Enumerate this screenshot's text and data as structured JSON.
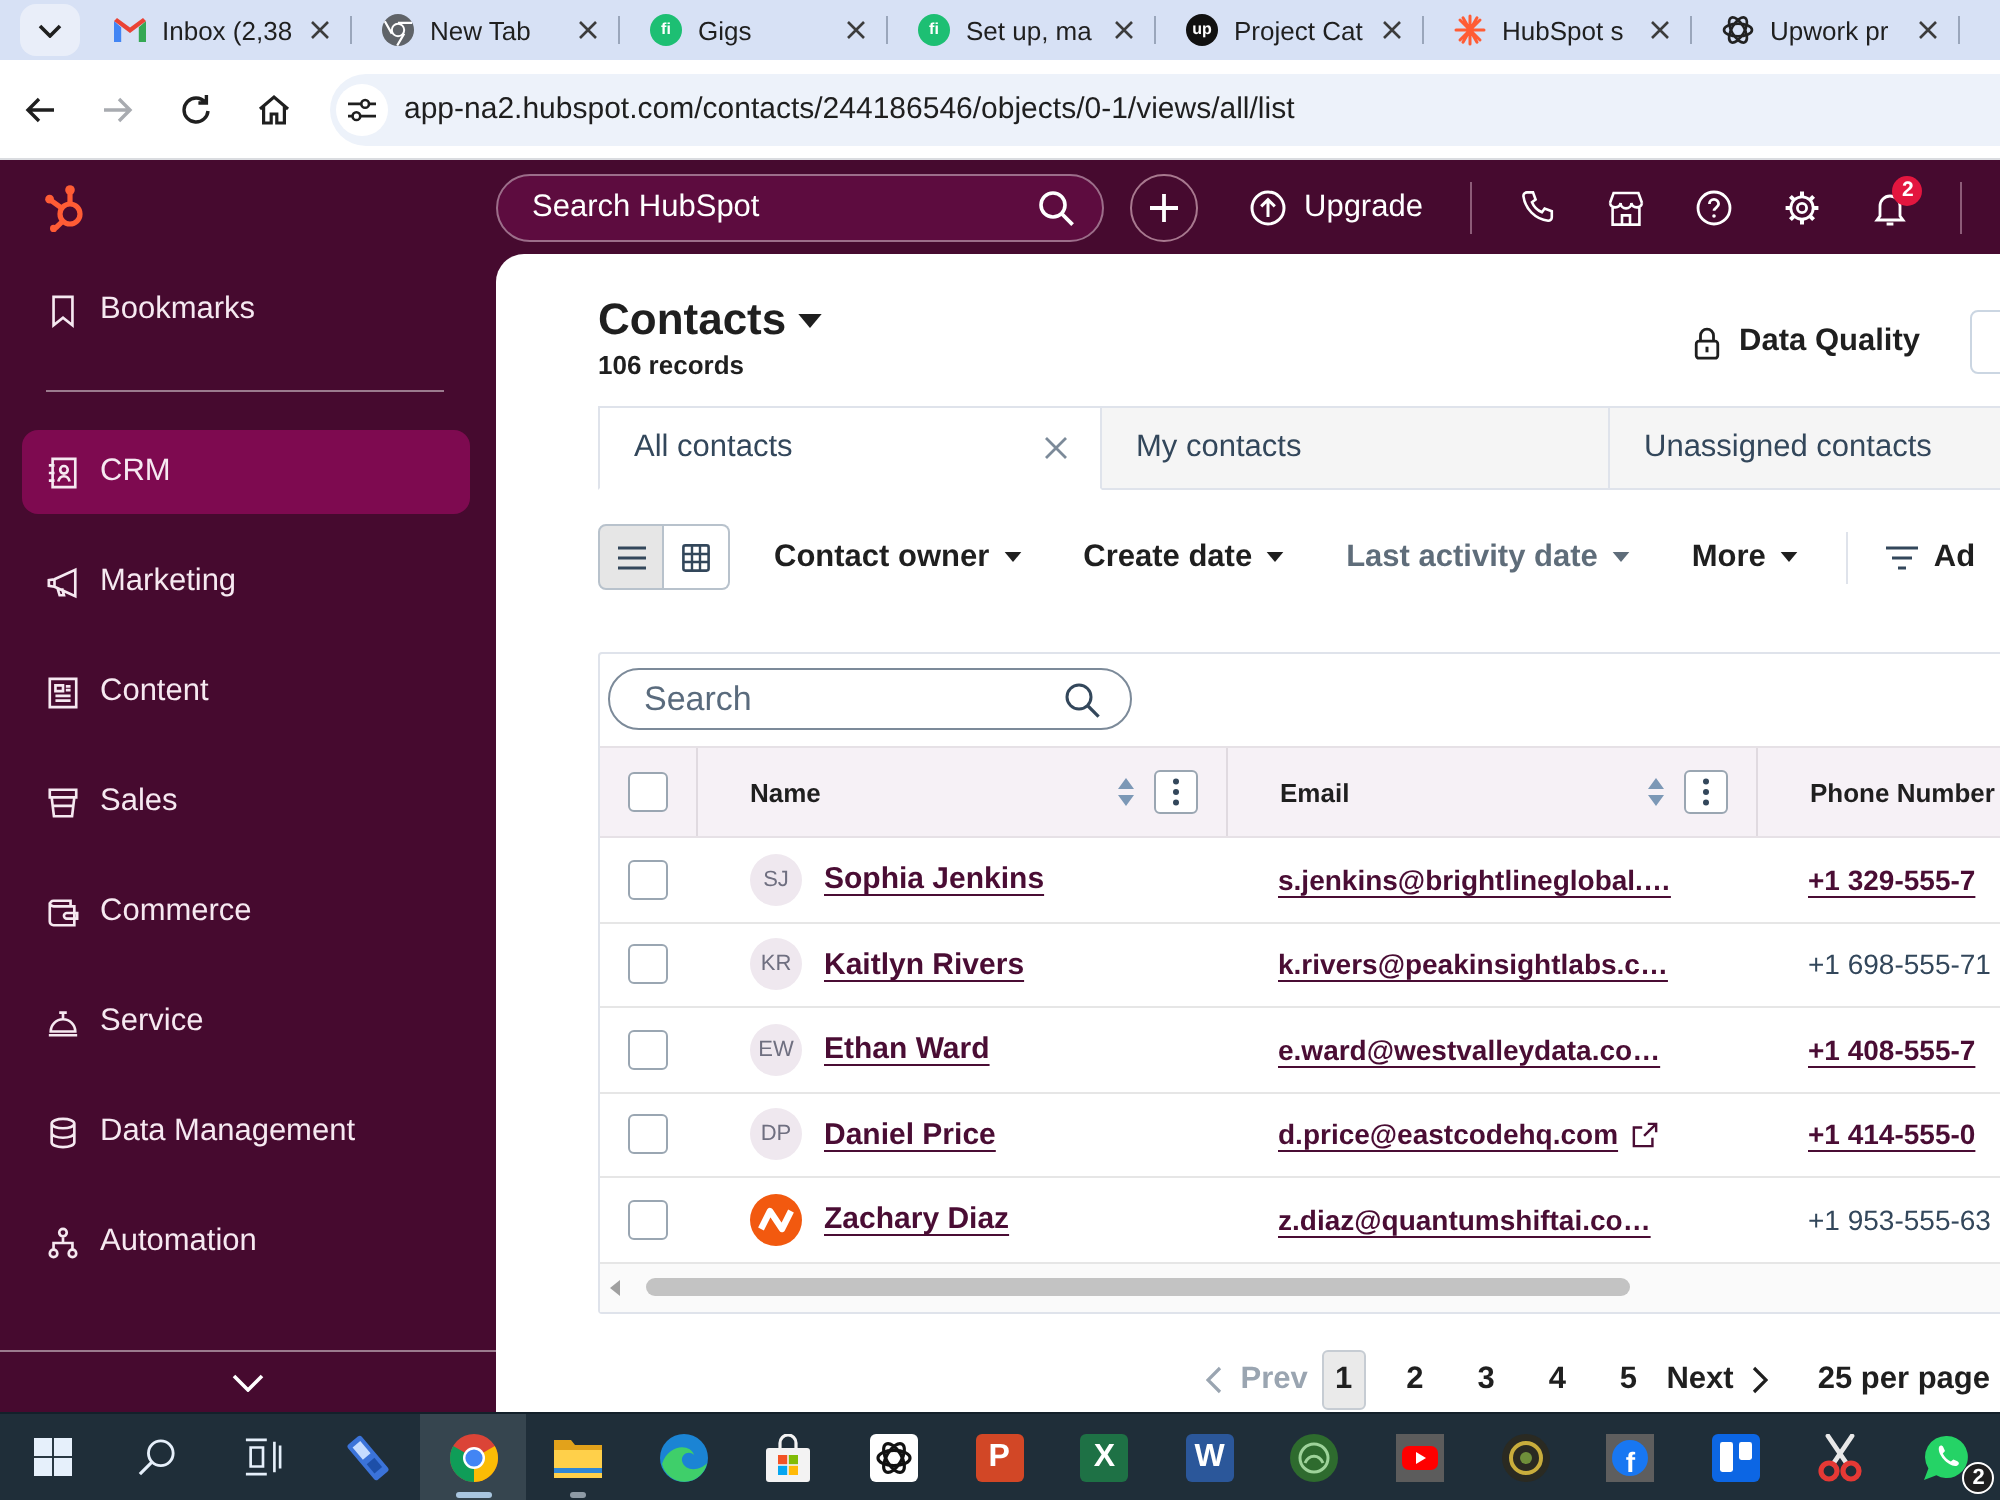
{
  "browser": {
    "tabs": [
      {
        "title": "Inbox (2,38",
        "kind": "mail",
        "selected": false
      },
      {
        "title": "New Tab",
        "kind": "chrome",
        "selected": false
      },
      {
        "title": "Gigs",
        "kind": "greenbadge",
        "icon_text": "fi",
        "selected": false
      },
      {
        "title": "Set up, ma",
        "kind": "greenbadge",
        "icon_text": "fi",
        "selected": false
      },
      {
        "title": "Project Cat",
        "kind": "darkbadge",
        "icon_text": "up",
        "selected": false
      },
      {
        "title": "HubSpot s",
        "kind": "starburst",
        "selected": false
      },
      {
        "title": "Upwork pr",
        "kind": "knot",
        "selected": false
      }
    ],
    "forward_disabled": true,
    "url": "app-na2.hubspot.com/contacts/244186546/objects/0-1/views/all/list"
  },
  "topnav": {
    "search": {
      "placeholder": "Search HubSpot"
    },
    "upgrade": "Upgrade",
    "notification_count": "2"
  },
  "sidebar": {
    "bookmarks": {
      "label": "Bookmarks"
    },
    "items": [
      {
        "label": "CRM",
        "kind": "contacts",
        "selected": true
      },
      {
        "label": "Marketing",
        "kind": "megaphone",
        "selected": false
      },
      {
        "label": "Content",
        "kind": "document",
        "selected": false
      },
      {
        "label": "Sales",
        "kind": "bucket",
        "selected": false
      },
      {
        "label": "Commerce",
        "kind": "wallet",
        "selected": false
      },
      {
        "label": "Service",
        "kind": "bell",
        "selected": false
      },
      {
        "label": "Data Management",
        "kind": "database",
        "selected": false
      },
      {
        "label": "Automation",
        "kind": "hierarchy",
        "selected": false
      }
    ]
  },
  "page": {
    "title": "Contacts",
    "record_count": "106 records",
    "data_quality": "Data Quality"
  },
  "views": [
    {
      "label": "All contacts",
      "selected": true,
      "closable": true
    },
    {
      "label": "My contacts",
      "selected": false,
      "closable": false
    },
    {
      "label": "Unassigned contacts",
      "selected": false,
      "closable": false
    }
  ],
  "toolbar": {
    "view_modes": [
      {
        "kind": "list",
        "selected": true
      },
      {
        "kind": "grid",
        "selected": false
      }
    ],
    "filters": [
      {
        "label": "Contact owner",
        "muted": false
      },
      {
        "label": "Create date",
        "muted": false
      },
      {
        "label": "Last activity date",
        "muted": true
      },
      {
        "label": "More",
        "muted": false
      }
    ],
    "advanced": "Ad"
  },
  "table": {
    "search": {
      "placeholder": "Search"
    },
    "header_checked": false,
    "columns": [
      {
        "label": "Name",
        "sortable": true
      },
      {
        "label": "Email",
        "sortable": true
      },
      {
        "label": "Phone Number",
        "sortable": false
      }
    ],
    "rows": [
      {
        "checked": false,
        "avatar": {
          "kind": "initials",
          "text": "SJ"
        },
        "name": "Sophia Jenkins",
        "email": "s.jenkins@brightlineglobal.…",
        "email_external": false,
        "phone": "+1 329-555-7",
        "phone_linked": true
      },
      {
        "checked": false,
        "avatar": {
          "kind": "initials",
          "text": "KR"
        },
        "name": "Kaitlyn Rivers",
        "email": "k.rivers@peakinsightlabs.c…",
        "email_external": false,
        "phone": "+1 698-555-71",
        "phone_linked": false
      },
      {
        "checked": false,
        "avatar": {
          "kind": "initials",
          "text": "EW"
        },
        "name": "Ethan Ward",
        "email": "e.ward@westvalleydata.co…",
        "email_external": false,
        "phone": "+1 408-555-7",
        "phone_linked": true
      },
      {
        "checked": false,
        "avatar": {
          "kind": "initials",
          "text": "DP"
        },
        "name": "Daniel Price",
        "email": "d.price@eastcodehq.com",
        "email_external": true,
        "phone": "+1 414-555-0",
        "phone_linked": true
      },
      {
        "checked": false,
        "avatar": {
          "kind": "logo"
        },
        "name": "Zachary Diaz",
        "email": "z.diaz@quantumshiftai.co…",
        "email_external": false,
        "phone": "+1 953-555-63",
        "phone_linked": false
      }
    ]
  },
  "pagination": {
    "prev": "Prev",
    "prev_disabled": true,
    "pages": [
      {
        "label": "1",
        "selected": true
      },
      {
        "label": "2",
        "selected": false
      },
      {
        "label": "3",
        "selected": false
      },
      {
        "label": "4",
        "selected": false
      },
      {
        "label": "5",
        "selected": false
      }
    ],
    "next": "Next",
    "per_page": "25 per page"
  },
  "taskbar": {
    "items": [
      {
        "kind": "windows",
        "selected": false,
        "running": false
      },
      {
        "kind": "search",
        "selected": false,
        "running": false
      },
      {
        "kind": "taskview",
        "selected": false,
        "running": false
      },
      {
        "kind": "usb",
        "selected": false,
        "running": false
      },
      {
        "kind": "chrome",
        "selected": true,
        "running": true
      },
      {
        "kind": "folder",
        "selected": false,
        "running": true
      },
      {
        "kind": "edge",
        "selected": false,
        "running": false
      },
      {
        "kind": "store",
        "selected": false,
        "running": false
      },
      {
        "kind": "knot",
        "selected": false,
        "running": false
      },
      {
        "kind": "presentation",
        "glyph": "P",
        "selected": false,
        "running": false
      },
      {
        "kind": "spreadsheet",
        "glyph": "X",
        "selected": false,
        "running": false
      },
      {
        "kind": "document",
        "glyph": "W",
        "selected": false,
        "running": false
      },
      {
        "kind": "emblem",
        "selected": false,
        "running": false
      },
      {
        "kind": "video",
        "selected": false,
        "running": false
      },
      {
        "kind": "seal",
        "selected": false,
        "running": false
      },
      {
        "kind": "social",
        "glyph": "f",
        "selected": false,
        "running": false
      },
      {
        "kind": "board",
        "selected": false,
        "running": false
      },
      {
        "kind": "paint",
        "selected": false,
        "running": false
      },
      {
        "kind": "chat",
        "badge": "2",
        "selected": false,
        "running": false
      }
    ]
  }
}
